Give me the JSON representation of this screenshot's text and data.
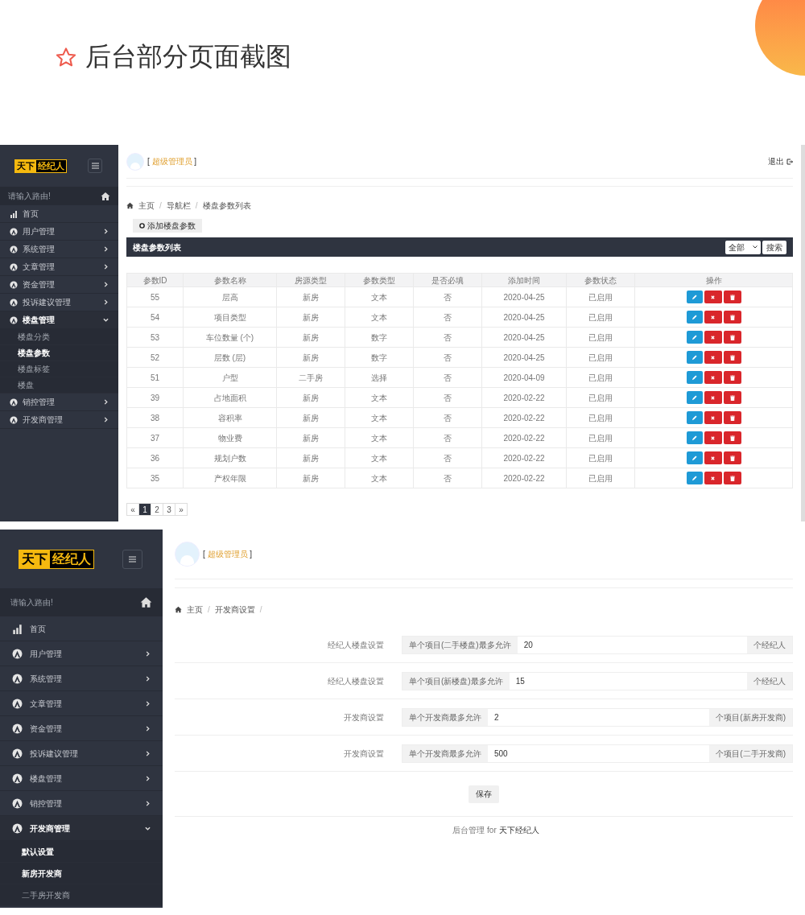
{
  "page_title": "后台部分页面截图",
  "screens": [
    {
      "kind": "list",
      "sidebar": {
        "logo": {
          "part1": "天下",
          "part2": "经纪人"
        },
        "search": {
          "placeholder": "请输入路由!"
        },
        "items": [
          {
            "label": "首页",
            "kind": "link"
          },
          {
            "label": "用户管理",
            "kind": "group",
            "expanded": false
          },
          {
            "label": "系统管理",
            "kind": "group",
            "expanded": false
          },
          {
            "label": "文章管理",
            "kind": "group",
            "expanded": false
          },
          {
            "label": "资金管理",
            "kind": "group",
            "expanded": false
          },
          {
            "label": "投诉建议管理",
            "kind": "group",
            "expanded": false
          },
          {
            "label": "楼盘管理",
            "kind": "group",
            "expanded": true,
            "children": [
              {
                "label": "楼盘分类",
                "selected": false
              },
              {
                "label": "楼盘参数",
                "selected": true
              },
              {
                "label": "楼盘标签",
                "selected": false
              },
              {
                "label": "楼盘",
                "selected": false
              }
            ]
          },
          {
            "label": "销控管理",
            "kind": "group",
            "expanded": false
          },
          {
            "label": "开发商管理",
            "kind": "group",
            "expanded": false
          }
        ]
      },
      "header": {
        "admin": {
          "open": "[",
          "name": "超级管理员",
          "close": "]"
        },
        "logout": "退出"
      },
      "breadcrumb": {
        "items": [
          "主页",
          "导航栏",
          "楼盘参数列表"
        ],
        "separator": "/"
      },
      "add_button": "添加楼盘参数",
      "panel": {
        "title": "楼盘参数列表",
        "filter": "全部",
        "search_button": "搜索"
      },
      "table": {
        "columns": [
          "参数ID",
          "参数名称",
          "房源类型",
          "参数类型",
          "是否必填",
          "添加时间",
          "参数状态",
          "操作"
        ],
        "rows": [
          {
            "cells": [
              "55",
              "层高",
              "新房",
              "文本",
              "否",
              "2020-04-25",
              "已启用"
            ]
          },
          {
            "cells": [
              "54",
              "项目类型",
              "新房",
              "文本",
              "否",
              "2020-04-25",
              "已启用"
            ]
          },
          {
            "cells": [
              "53",
              "车位数量 (个)",
              "新房",
              "数字",
              "否",
              "2020-04-25",
              "已启用"
            ]
          },
          {
            "cells": [
              "52",
              "层数 (层)",
              "新房",
              "数字",
              "否",
              "2020-04-25",
              "已启用"
            ]
          },
          {
            "cells": [
              "51",
              "户型",
              "二手房",
              "选择",
              "否",
              "2020-04-09",
              "已启用"
            ]
          },
          {
            "cells": [
              "39",
              "占地面积",
              "新房",
              "文本",
              "否",
              "2020-02-22",
              "已启用"
            ]
          },
          {
            "cells": [
              "38",
              "容积率",
              "新房",
              "文本",
              "否",
              "2020-02-22",
              "已启用"
            ]
          },
          {
            "cells": [
              "37",
              "物业费",
              "新房",
              "文本",
              "否",
              "2020-02-22",
              "已启用"
            ]
          },
          {
            "cells": [
              "36",
              "规划户数",
              "新房",
              "文本",
              "否",
              "2020-02-22",
              "已启用"
            ]
          },
          {
            "cells": [
              "35",
              "产权年限",
              "新房",
              "文本",
              "否",
              "2020-02-22",
              "已启用"
            ]
          }
        ]
      },
      "pagination": [
        {
          "label": "«",
          "selected": false
        },
        {
          "label": "1",
          "selected": true
        },
        {
          "label": "2",
          "selected": false
        },
        {
          "label": "3",
          "selected": false
        },
        {
          "label": "»",
          "selected": false
        }
      ]
    },
    {
      "kind": "settings",
      "sidebar": {
        "logo": {
          "part1": "天下",
          "part2": "经纪人"
        },
        "search": {
          "placeholder": "请输入路由!"
        },
        "items": [
          {
            "label": "首页",
            "kind": "link"
          },
          {
            "label": "用户管理",
            "kind": "group",
            "expanded": false
          },
          {
            "label": "系统管理",
            "kind": "group",
            "expanded": false
          },
          {
            "label": "文章管理",
            "kind": "group",
            "expanded": false
          },
          {
            "label": "资金管理",
            "kind": "group",
            "expanded": false
          },
          {
            "label": "投诉建议管理",
            "kind": "group",
            "expanded": false
          },
          {
            "label": "楼盘管理",
            "kind": "group",
            "expanded": false
          },
          {
            "label": "销控管理",
            "kind": "group",
            "expanded": false
          },
          {
            "label": "开发商管理",
            "kind": "group",
            "expanded": true,
            "children": [
              {
                "label": "默认设置",
                "selected": true
              },
              {
                "label": "新房开发商",
                "selected": true
              },
              {
                "label": "二手房开发商",
                "selected": false
              }
            ]
          }
        ]
      },
      "header": {
        "admin": {
          "open": "[",
          "name": "超级管理员",
          "close": "]"
        }
      },
      "breadcrumb": {
        "items": [
          "主页",
          "开发商设置"
        ],
        "separator": "/",
        "trailing": true
      },
      "form": [
        {
          "label": "经纪人楼盘设置",
          "prefix": "单个项目(二手楼盘)最多允许",
          "value": "20",
          "suffix": "个经纪人"
        },
        {
          "label": "经纪人楼盘设置",
          "prefix": "单个项目(新楼盘)最多允许",
          "value": "15",
          "suffix": "个经纪人"
        },
        {
          "label": "开发商设置",
          "prefix": "单个开发商最多允许",
          "value": "2",
          "suffix": "个项目(新房开发商)"
        },
        {
          "label": "开发商设置",
          "prefix": "单个开发商最多允许",
          "value": "500",
          "suffix": "个项目(二手开发商)"
        }
      ],
      "save_button": "保存",
      "footer": {
        "text": "后台管理 for",
        "brand": "天下经纪人"
      }
    }
  ]
}
